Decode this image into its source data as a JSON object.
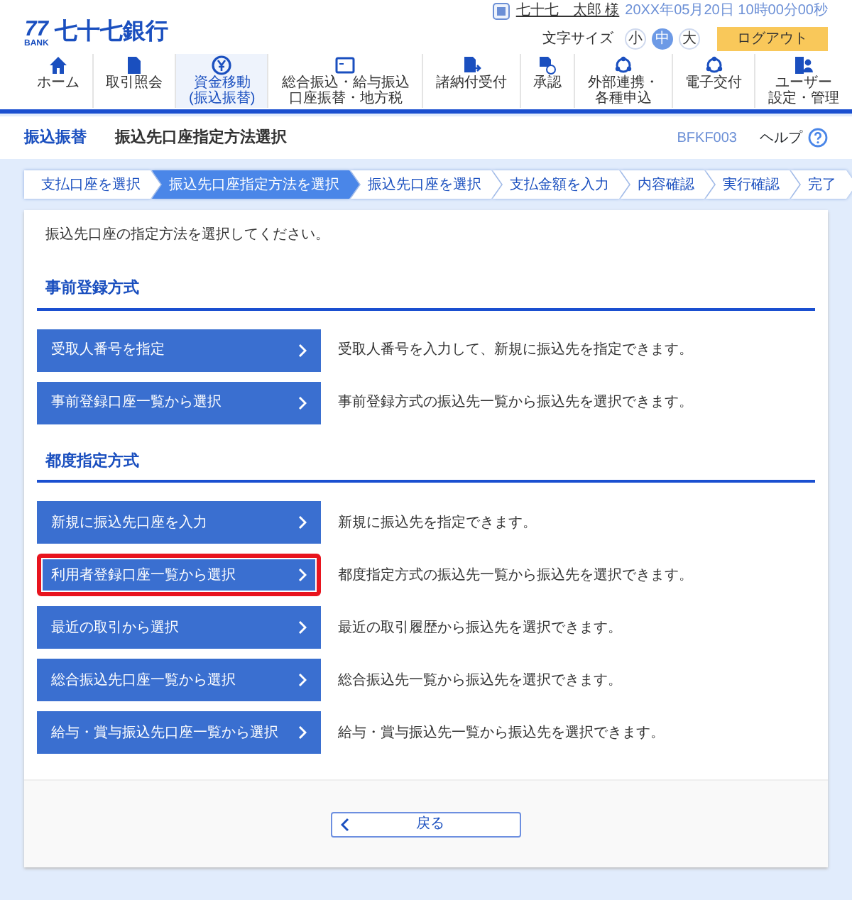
{
  "header": {
    "bank_name": "七十七銀行",
    "logo_mark": "77",
    "logo_sub": "BANK",
    "user_name": "七十七　太郎 様",
    "datetime": "20XX年05月20日 10時00分00秒",
    "font_size_label": "文字サイズ",
    "font_sizes": [
      {
        "label": "小",
        "selected": false
      },
      {
        "label": "中",
        "selected": true
      },
      {
        "label": "大",
        "selected": false
      }
    ],
    "logout": "ログアウト"
  },
  "nav": [
    {
      "lines": [
        "ホーム"
      ],
      "selected": false
    },
    {
      "lines": [
        "取引照会"
      ],
      "selected": false
    },
    {
      "lines": [
        "資金移動",
        "(振込振替)"
      ],
      "selected": true
    },
    {
      "lines": [
        "総合振込・給与振込",
        "口座振替・地方税"
      ],
      "selected": false
    },
    {
      "lines": [
        "諸納付受付"
      ],
      "selected": false
    },
    {
      "lines": [
        "承認"
      ],
      "selected": false
    },
    {
      "lines": [
        "外部連携・",
        "各種申込"
      ],
      "selected": false
    },
    {
      "lines": [
        "電子交付"
      ],
      "selected": false
    },
    {
      "lines": [
        "ユーザー",
        "設定・管理"
      ],
      "selected": false
    }
  ],
  "title_bar": {
    "section": "振込振替",
    "title": "振込先口座指定方法選択",
    "screen_id": "BFKF003",
    "help": "ヘルプ"
  },
  "steps": [
    {
      "label": "支払口座を選択",
      "selected": false
    },
    {
      "label": "振込先口座指定方法を選択",
      "selected": true
    },
    {
      "label": "振込先口座を選択",
      "selected": false
    },
    {
      "label": "支払金額を入力",
      "selected": false
    },
    {
      "label": "内容確認",
      "selected": false
    },
    {
      "label": "実行確認",
      "selected": false
    },
    {
      "label": "完了",
      "selected": false
    }
  ],
  "intro": "振込先口座の指定方法を選択してください。",
  "sections": [
    {
      "heading": "事前登録方式",
      "options": [
        {
          "label": "受取人番号を指定",
          "description": "受取人番号を入力して、新規に振込先を指定できます。",
          "highlighted": false
        },
        {
          "label": "事前登録口座一覧から選択",
          "description": "事前登録方式の振込先一覧から振込先を選択できます。",
          "highlighted": false
        }
      ]
    },
    {
      "heading": "都度指定方式",
      "options": [
        {
          "label": "新規に振込先口座を入力",
          "description": "新規に振込先を指定できます。",
          "highlighted": false
        },
        {
          "label": "利用者登録口座一覧から選択",
          "description": "都度指定方式の振込先一覧から振込先を選択できます。",
          "highlighted": true
        },
        {
          "label": "最近の取引から選択",
          "description": "最近の取引履歴から振込先を選択できます。",
          "highlighted": false
        },
        {
          "label": "総合振込先口座一覧から選択",
          "description": "総合振込先一覧から振込先を選択できます。",
          "highlighted": false
        },
        {
          "label": "給与・賞与振込先口座一覧から選択",
          "description": "給与・賞与振込先一覧から振込先を選択できます。",
          "highlighted": false
        }
      ]
    }
  ],
  "back_button": "戻る"
}
